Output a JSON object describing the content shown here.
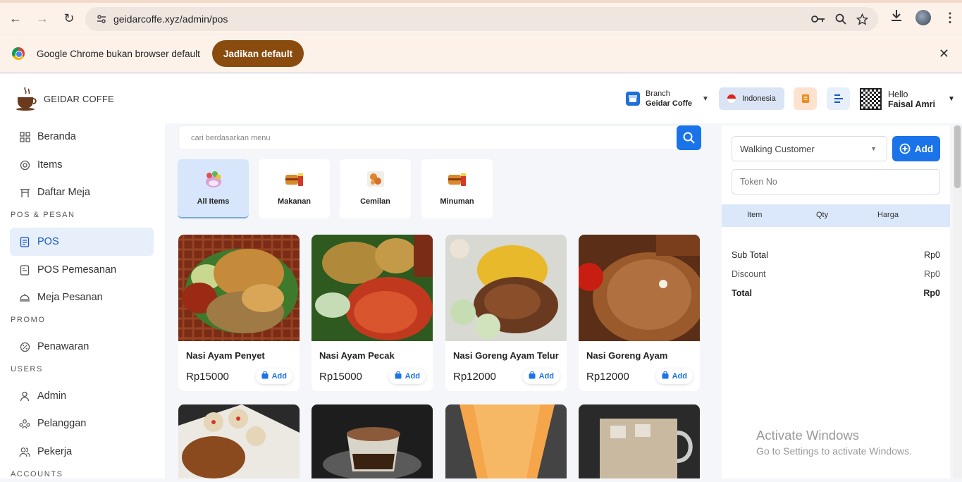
{
  "browser": {
    "url": "geidarcoffe.xyz/admin/pos",
    "infobar_message": "Google Chrome bukan browser default",
    "infobar_button": "Jadikan default"
  },
  "header": {
    "logo_text": "GEIDAR COFFE",
    "branch_label": "Branch",
    "branch_name": "Geidar Coffe",
    "language": "Indonesia",
    "greeting": "Hello",
    "user_name": "Faisal Amri"
  },
  "sidebar": {
    "items": [
      {
        "label": "Beranda",
        "icon": "grid-icon"
      },
      {
        "label": "Items",
        "icon": "box-icon"
      },
      {
        "label": "Daftar Meja",
        "icon": "table-icon"
      }
    ],
    "sections": [
      {
        "heading": "POS & PESAN",
        "items": [
          {
            "label": "POS",
            "icon": "receipt-icon"
          },
          {
            "label": "POS Pemesanan",
            "icon": "order-icon"
          },
          {
            "label": "Meja Pesanan",
            "icon": "dining-icon"
          }
        ]
      },
      {
        "heading": "PROMO",
        "items": [
          {
            "label": "Penawaran",
            "icon": "offer-icon"
          }
        ]
      },
      {
        "heading": "USERS",
        "items": [
          {
            "label": "Admin",
            "icon": "user-icon"
          },
          {
            "label": "Pelanggan",
            "icon": "customers-icon"
          },
          {
            "label": "Pekerja",
            "icon": "employees-icon"
          }
        ]
      },
      {
        "heading": "ACCOUNTS",
        "items": []
      }
    ],
    "active": "POS",
    "accent_color": "#1a56c4"
  },
  "main": {
    "search_placeholder": "cari berdasarkan menu",
    "categories": [
      "All Items",
      "Makanan",
      "Cemilan",
      "Minuman"
    ],
    "active_category": "All Items",
    "products": [
      {
        "name": "Nasi Ayam Penyet",
        "price": "Rp15000",
        "add_label": "Add"
      },
      {
        "name": "Nasi Ayam Pecak",
        "price": "Rp15000",
        "add_label": "Add"
      },
      {
        "name": "Nasi Goreng Ayam Telur",
        "price": "Rp12000",
        "add_label": "Add"
      },
      {
        "name": "Nasi Goreng Ayam",
        "price": "Rp12000",
        "add_label": "Add"
      }
    ]
  },
  "cart": {
    "customer_select": "Walking Customer",
    "add_button": "Add",
    "token_placeholder": "Token No",
    "columns": [
      "Item",
      "Qty",
      "Harga"
    ],
    "subtotal_label": "Sub Total",
    "subtotal_value": "Rp0",
    "discount_label": "Discount",
    "discount_value": "Rp0",
    "total_label": "Total",
    "total_value": "Rp0"
  },
  "watermark": {
    "title": "Activate Windows",
    "subtitle": "Go to Settings to activate Windows."
  }
}
